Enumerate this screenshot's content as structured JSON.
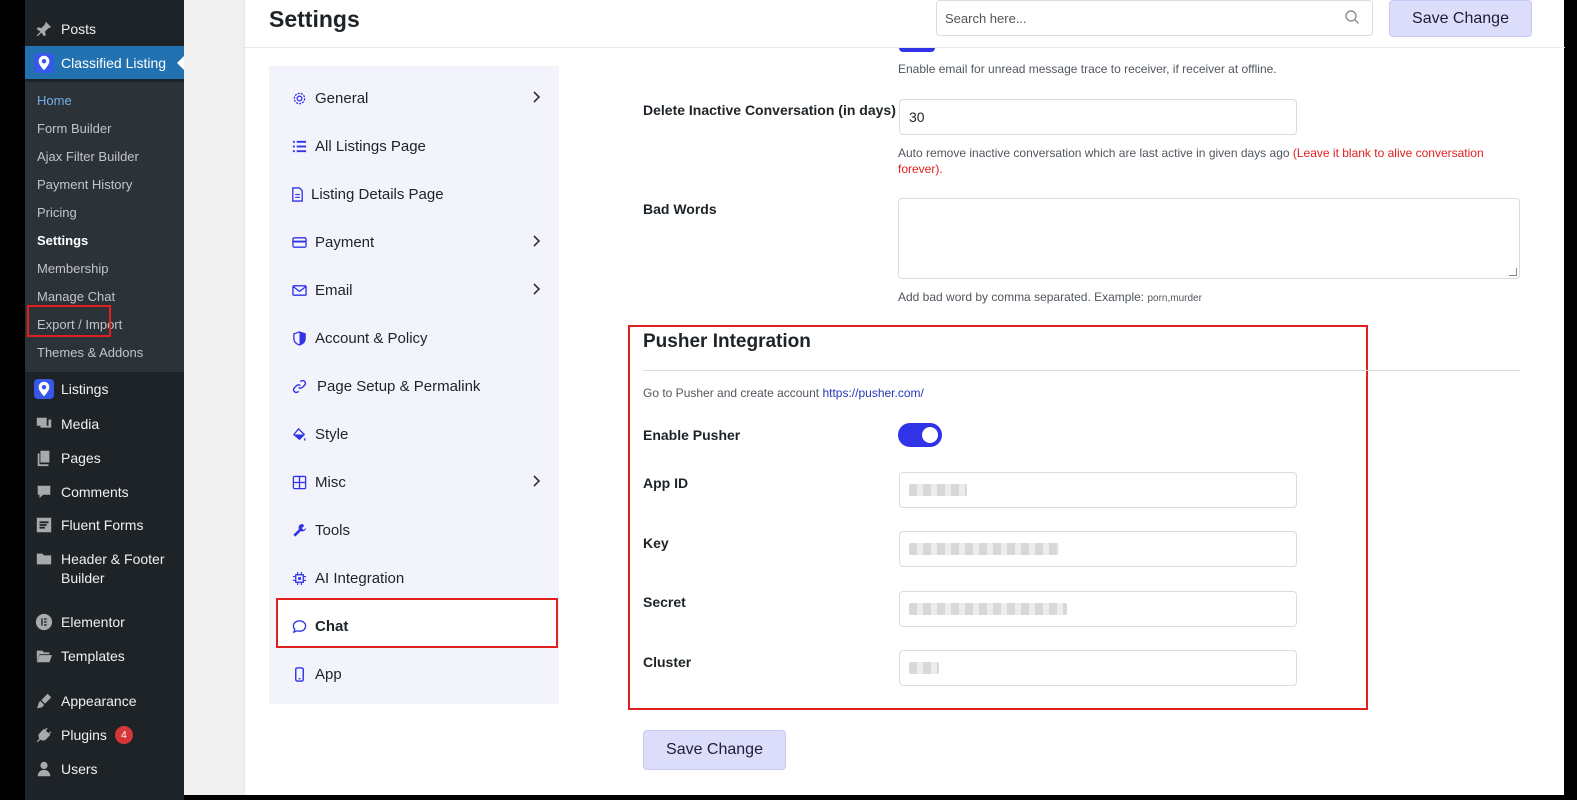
{
  "wp_menu": {
    "posts": "Posts",
    "classified_listing": "Classified Listing",
    "submenu": [
      "Home",
      "Form Builder",
      "Ajax Filter Builder",
      "Payment History",
      "Pricing",
      "Settings",
      "Membership",
      "Manage Chat",
      "Export / Import",
      "Themes & Addons"
    ],
    "listings": "Listings",
    "media": "Media",
    "pages": "Pages",
    "comments": "Comments",
    "fluent_forms": "Fluent Forms",
    "header_footer": "Header & Footer",
    "header_footer_2": "Builder",
    "elementor": "Elementor",
    "templates": "Templates",
    "appearance": "Appearance",
    "plugins": "Plugins",
    "plugins_badge": "4",
    "users": "Users"
  },
  "header": {
    "title": "Settings",
    "search_placeholder": "Search here...",
    "save_label": "Save Change"
  },
  "settings_nav": [
    "General",
    "All Listings Page",
    "Listing Details Page",
    "Payment",
    "Email",
    "Account & Policy",
    "Page Setup & Permalink",
    "Style",
    "Misc",
    "Tools",
    "AI Integration",
    "Chat",
    "App"
  ],
  "form": {
    "email_help": "Enable email for unread message trace to receiver, if receiver at offline.",
    "delete_label": "Delete Inactive Conversation (in days)",
    "delete_value": "30",
    "delete_help": "Auto remove inactive conversation which are last active in given days ago ",
    "delete_help_red_1": "(Leave it blank to alive conversation",
    "delete_help_red_2": "forever).",
    "bad_words_label": "Bad Words",
    "bad_words_help": "Add bad word by comma separated. Example: ",
    "bad_words_example": "porn,murder",
    "pusher_title": "Pusher Integration",
    "pusher_help": "Go to Pusher and create account ",
    "pusher_link": "https://pusher.com/",
    "enable_pusher_label": "Enable Pusher",
    "enable_pusher_on": true,
    "app_id_label": "App ID",
    "key_label": "Key",
    "secret_label": "Secret",
    "cluster_label": "Cluster",
    "save_label": "Save Change"
  },
  "colors": {
    "accent": "#3033e6",
    "highlight": "#e0201d",
    "wp_active": "#2271b1"
  }
}
